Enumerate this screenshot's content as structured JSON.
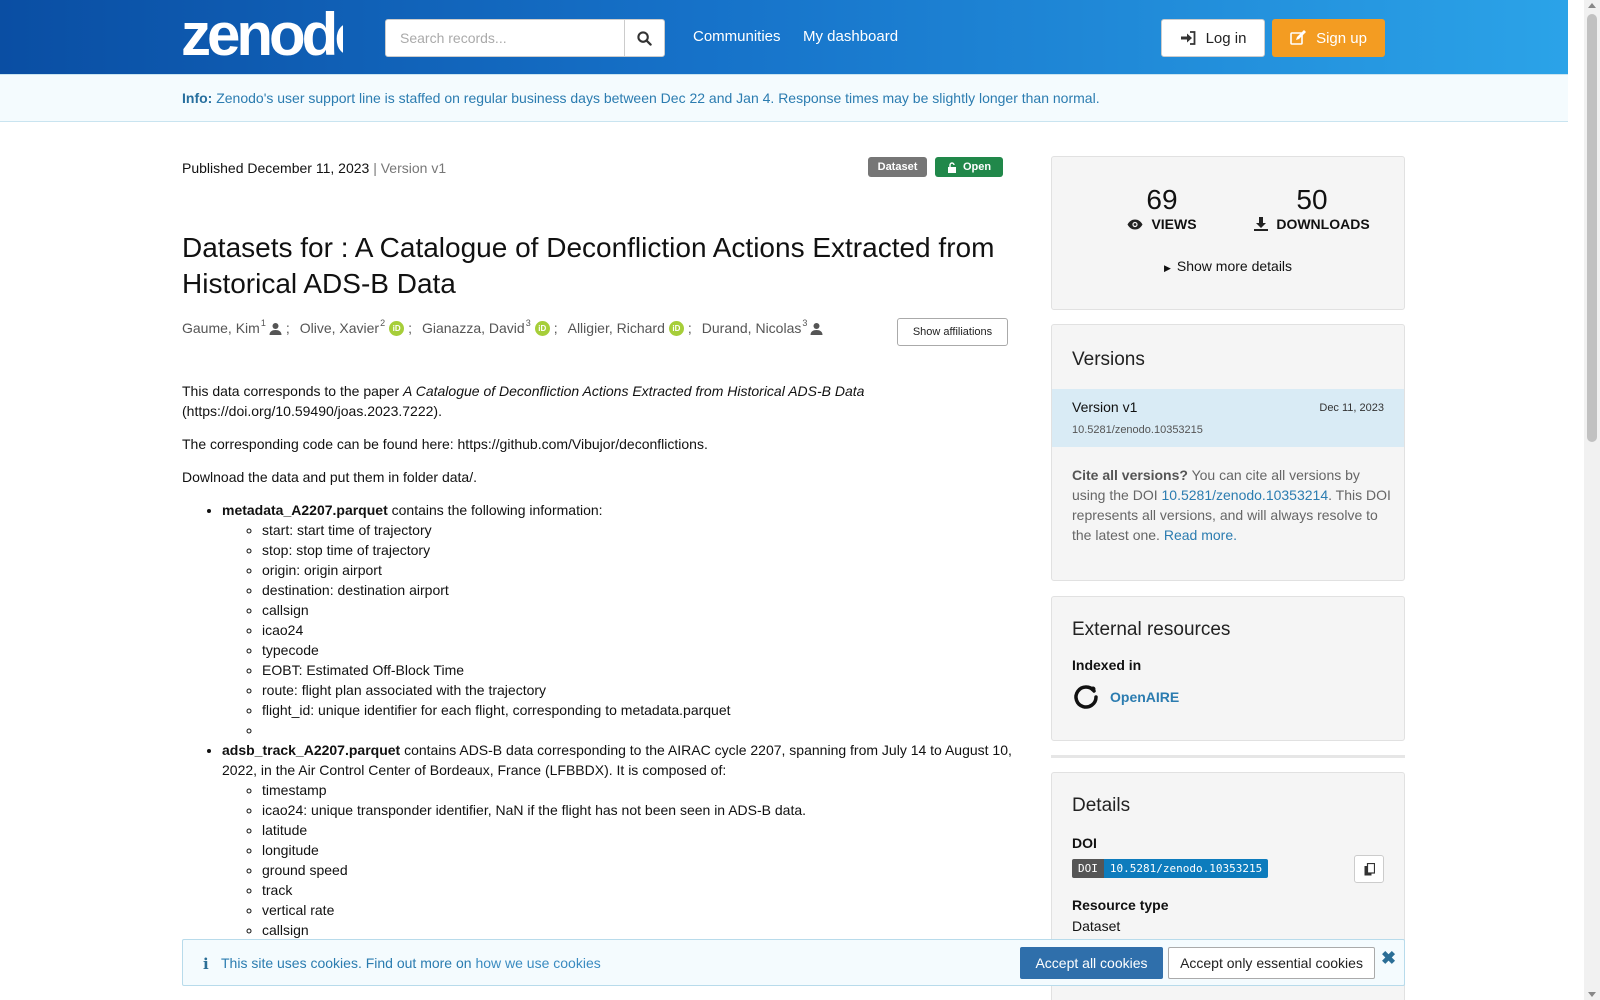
{
  "header": {
    "logo_text": "zenodo",
    "search_placeholder": "Search records...",
    "nav": [
      {
        "label": "Communities"
      },
      {
        "label": "My dashboard"
      }
    ],
    "login_label": "Log in",
    "signup_label": "Sign up"
  },
  "info_banner": {
    "label": "Info:",
    "text": "Zenodo's user support line is staffed on regular business days between Dec 22 and Jan 4. Response times may be slightly longer than normal."
  },
  "record": {
    "published": "Published December 11, 2023",
    "version": "| Version v1",
    "badge_type": "Dataset",
    "badge_access": "Open",
    "title": "Datasets for : A Catalogue of Deconfliction Actions Extracted from Historical ADS-B Data",
    "authors": [
      {
        "name": "Gaume, Kim",
        "aff": "1",
        "icon": "user-icon"
      },
      {
        "name": "Olive, Xavier",
        "aff": "2",
        "icon": "orcid-icon"
      },
      {
        "name": "Gianazza, David",
        "aff": "3",
        "icon": "orcid-icon"
      },
      {
        "name": "Alligier, Richard",
        "aff": "",
        "icon": "orcid-icon"
      },
      {
        "name": "Durand, Nicolas",
        "aff": "3",
        "icon": "user-icon"
      }
    ],
    "author_separator": ";",
    "show_affiliations_label": "Show affiliations",
    "description": {
      "p1_prefix": "This data corresponds to the paper ",
      "p1_italic": "A Catalogue of Deconfliction Actions Extracted from Historical ADS-B Data",
      "p1_suffix": " (https://doi.org/10.59490/joas.2023.7222).",
      "p2": "The corresponding code can be found here: https://github.com/Vibujor/deconflictions.",
      "p3": "Dowlnoad the data and put them in folder data/.",
      "files": [
        {
          "name": "metadata_A2207.parquet",
          "text": " contains the following information:",
          "items": [
            "start: start time of trajectory",
            "stop: stop time of trajectory",
            "origin: origin airport",
            "destination: destination airport",
            "callsign",
            "icao24",
            "typecode",
            "EOBT: Estimated Off-Block Time",
            "route: flight plan associated with the trajectory",
            "flight_id: unique identifier for each flight, corresponding to metadata.parquet",
            ""
          ]
        },
        {
          "name": "adsb_track_A2207.parquet",
          "text": " contains ADS-B data corresponding to the AIRAC cycle 2207, spanning from July 14 to August 10, 2022, in the Air Control Center of Bordeaux, France (LFBBDX). It is composed of:",
          "items": [
            "timestamp",
            "icao24: unique transponder identifier, NaN if the flight has not been seen in ADS-B data.",
            "latitude",
            "longitude",
            "ground speed",
            "track",
            "vertical rate",
            "callsign"
          ]
        }
      ]
    }
  },
  "sidebar": {
    "stats": {
      "views_value": "69",
      "views_label": "VIEWS",
      "downloads_value": "50",
      "downloads_label": "DOWNLOADS",
      "more_details": "Show more details"
    },
    "versions": {
      "title": "Versions",
      "current_label": "Version v1",
      "current_doi": "10.5281/zenodo.10353215",
      "current_date": "Dec 11, 2023",
      "cite_bold": "Cite all versions?",
      "cite_text1": " You can cite all versions by using the DOI ",
      "cite_doi": "10.5281/zenodo.10353214",
      "cite_text2": ". This DOI represents all versions, and will always resolve to the latest one. ",
      "read_more": "Read more."
    },
    "external": {
      "title": "External resources",
      "indexed_in": "Indexed in",
      "openaire": "OpenAIRE"
    },
    "details": {
      "title": "Details",
      "doi_label": "DOI",
      "doi_key": "DOI",
      "doi_value": "10.5281/zenodo.10353215",
      "resource_type_label": "Resource type",
      "resource_type_value": "Dataset"
    }
  },
  "cookie_bar": {
    "text": "This site uses cookies. Find out more on ",
    "link": "how we use cookies",
    "accept_all": "Accept all cookies",
    "accept_essential": "Accept only essential cookies",
    "close_glyph": "✖"
  },
  "colors": {
    "header_start": "#0a4ea3",
    "header_end": "#2ba3e8",
    "signup": "#f39c22",
    "open_badge": "#21884a",
    "link": "#2b7cb0",
    "orcid": "#a6ce39"
  }
}
